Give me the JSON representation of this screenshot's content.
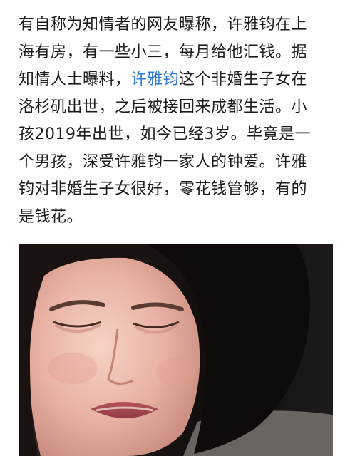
{
  "article": {
    "lines": [
      {
        "text": "有自称为知情者的网友曝称，许雅钧在上"
      },
      {
        "text": "海有房，有一些小三，每月给他汇钱。据"
      },
      {
        "before": "知情人士曝料，",
        "link": "许雅钧",
        "after": "这个非婚生子女在"
      },
      {
        "text": "洛杉矶出世，之后被接回来成都生活。小"
      },
      {
        "text": "孩2019年出世，如今已经3岁。毕竟是一"
      },
      {
        "text": "个男孩，深受许雅钧一家人的钟爱。许雅"
      },
      {
        "text": "钧对非婚生子女很好，零花钱管够，有的"
      },
      {
        "text": "是钱花。"
      }
    ],
    "link_color": "#2f7bd6"
  },
  "photo": {
    "subject": "crying-woman-photo"
  }
}
